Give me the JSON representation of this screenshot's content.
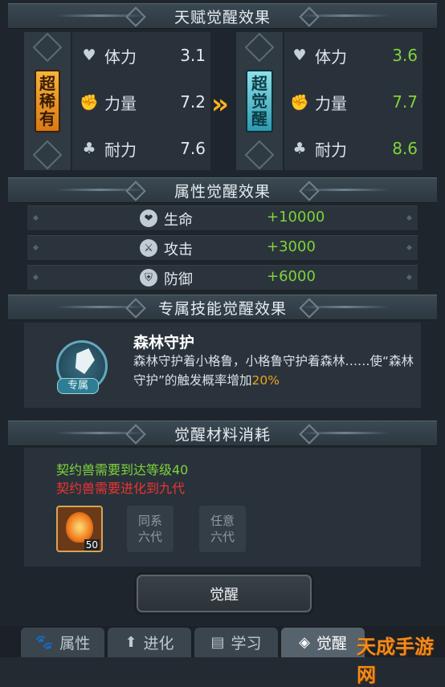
{
  "sections": {
    "talent": "天赋觉醒效果",
    "attribute": "属性觉醒效果",
    "skill": "专属技能觉醒效果",
    "material": "觉醒材料消耗"
  },
  "talent": {
    "before_tag": "超稀有",
    "after_tag": "超觉醒",
    "before": [
      {
        "label": "体力",
        "value": "3.1",
        "icon": "heart-icon"
      },
      {
        "label": "力量",
        "value": "7.2",
        "icon": "fist-icon"
      },
      {
        "label": "耐力",
        "value": "7.6",
        "icon": "club-icon"
      }
    ],
    "after": [
      {
        "label": "体力",
        "value": "3.6",
        "icon": "heart-icon"
      },
      {
        "label": "力量",
        "value": "7.7",
        "icon": "fist-icon"
      },
      {
        "label": "耐力",
        "value": "8.6",
        "icon": "club-icon"
      }
    ],
    "arrow": "»"
  },
  "attributes": [
    {
      "label": "生命",
      "value": "+10000",
      "icon": "health-icon"
    },
    {
      "label": "攻击",
      "value": "+3000",
      "icon": "attack-icon"
    },
    {
      "label": "防御",
      "value": "+6000",
      "icon": "defense-icon"
    }
  ],
  "skill": {
    "tag": "专属",
    "name": "森林守护",
    "desc_prefix": "森林守护着小格鲁，小格鲁守护着森林……使“森林守护”的触发概率增加",
    "desc_highlight": "20%"
  },
  "material": {
    "req_met": "契约兽需要到达等级40",
    "req_unmet": "契约兽需要进化到九代",
    "item_count": "50",
    "slot2_line1": "同系",
    "slot2_line2": "六代",
    "slot3_line1": "任意",
    "slot3_line2": "六代"
  },
  "awaken_button": "觉醒",
  "tabs": [
    {
      "label": "属性",
      "icon": "paw-icon"
    },
    {
      "label": "进化",
      "icon": "arrow-up-icon"
    },
    {
      "label": "学习",
      "icon": "book-icon"
    },
    {
      "label": "觉醒",
      "icon": "beast-icon"
    }
  ],
  "watermark": "天成手游网",
  "colors": {
    "positive": "#7ed33b",
    "negative": "#ef3232",
    "highlight": "#f0a31b",
    "arrow": "#ffb120"
  }
}
